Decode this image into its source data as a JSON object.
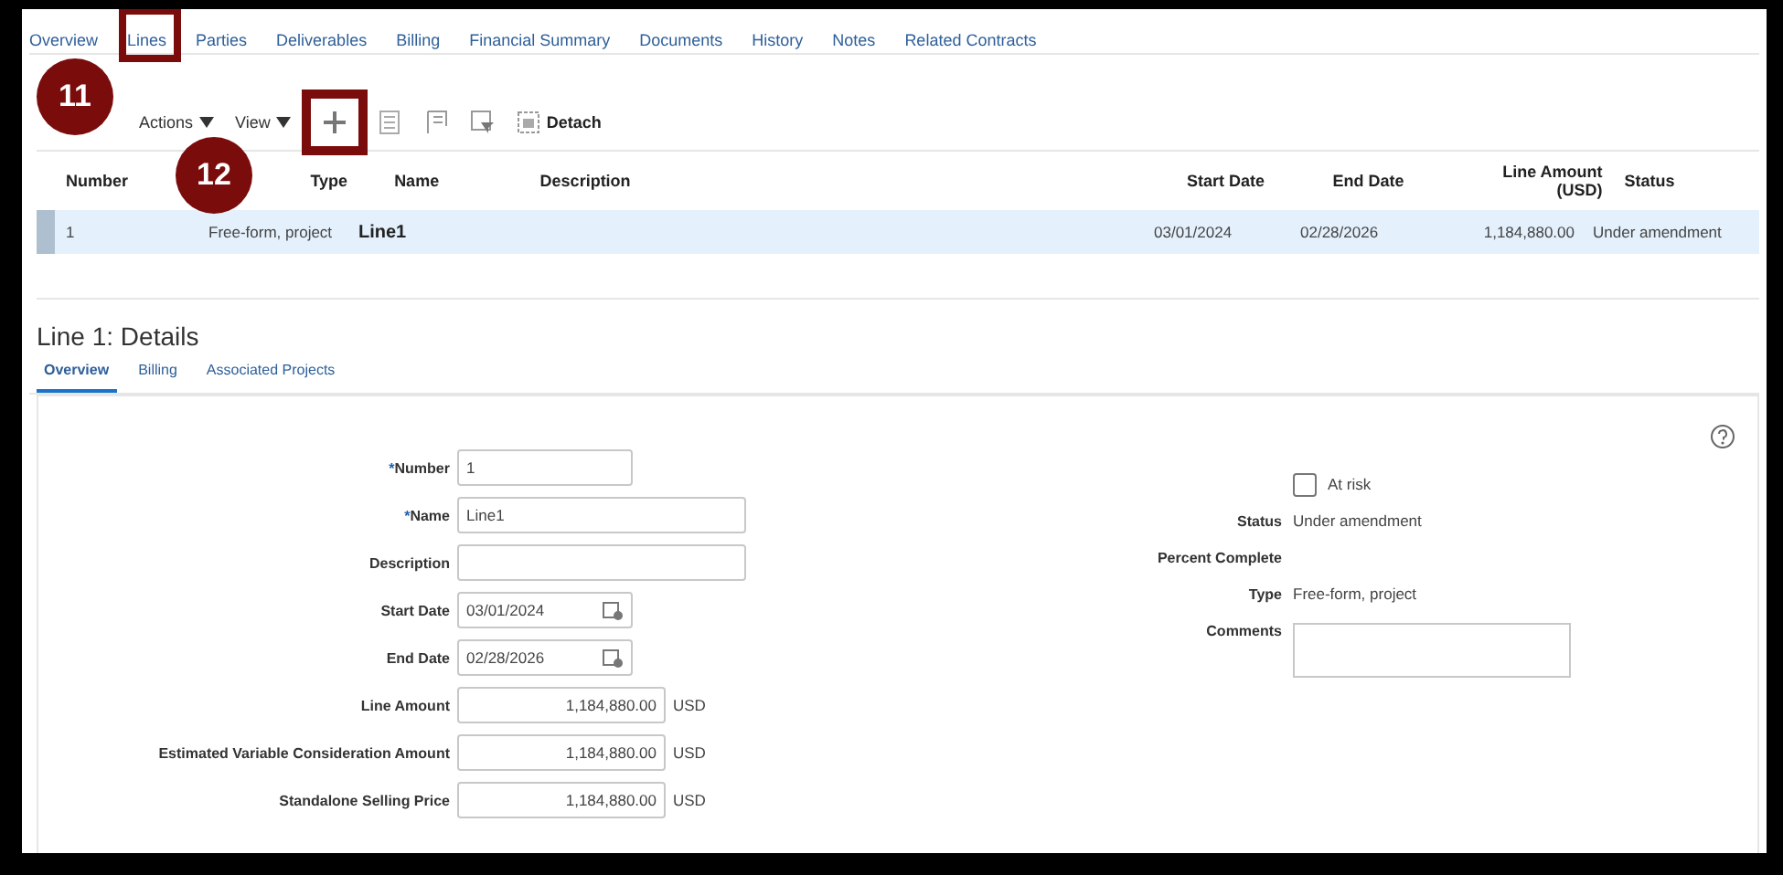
{
  "tabs": [
    {
      "label": "Overview",
      "selected": false
    },
    {
      "label": "Lines",
      "selected": true
    },
    {
      "label": "Parties",
      "selected": false
    },
    {
      "label": "Deliverables",
      "selected": false
    },
    {
      "label": "Billing",
      "selected": false
    },
    {
      "label": "Financial Summary",
      "selected": false
    },
    {
      "label": "Documents",
      "selected": false
    },
    {
      "label": "History",
      "selected": false
    },
    {
      "label": "Notes",
      "selected": false
    },
    {
      "label": "Related Contracts",
      "selected": false
    }
  ],
  "callouts": [
    "11",
    "12"
  ],
  "toolbar": {
    "menus": [
      "Actions",
      "View"
    ],
    "detach": "Detach"
  },
  "table": {
    "columns": [
      "Number",
      "Type",
      "Name",
      "Description",
      "Start Date",
      "End Date",
      "Line Amount (USD)",
      "Status"
    ],
    "rows": [
      {
        "selected": true,
        "cells": [
          "1",
          "Free-form, project",
          "Line1",
          "",
          "03/01/2024",
          "02/28/2026",
          "1,184,880.00",
          "Under amendment"
        ]
      }
    ]
  },
  "details": {
    "title": "Line 1: Details",
    "tabs": [
      {
        "label": "Overview",
        "selected": true
      },
      {
        "label": "Billing",
        "selected": false
      },
      {
        "label": "Associated Projects",
        "selected": false
      }
    ],
    "fields": [
      {
        "label": "Number",
        "required_mark": "*",
        "value": "1",
        "kind": "short"
      },
      {
        "label": "Name",
        "required_mark": "*",
        "value": "Line1",
        "kind": "long"
      },
      {
        "label": "Description",
        "kind": "long"
      },
      {
        "label": "Start Date",
        "value": "03/01/2024",
        "kind": "date"
      },
      {
        "label": "End Date",
        "value": "02/28/2026",
        "kind": "date"
      },
      {
        "label": "Line Amount",
        "value": "1,184,880.00",
        "kind": "amount",
        "unit": "USD"
      },
      {
        "label": "Estimated Variable Consideration Amount",
        "value": "1,184,880.00",
        "kind": "amount",
        "unit": "USD"
      },
      {
        "label": "Standalone Selling Price",
        "value": "1,184,880.00",
        "kind": "amount",
        "unit": "USD"
      }
    ],
    "at_risk": {
      "label": "At risk",
      "checked": false
    },
    "info": [
      {
        "label": "Status",
        "value": "Under amendment"
      },
      {
        "label": "Percent Complete"
      },
      {
        "label": "Type",
        "value": "Free-form, project"
      }
    ],
    "comments_label": "Comments"
  }
}
